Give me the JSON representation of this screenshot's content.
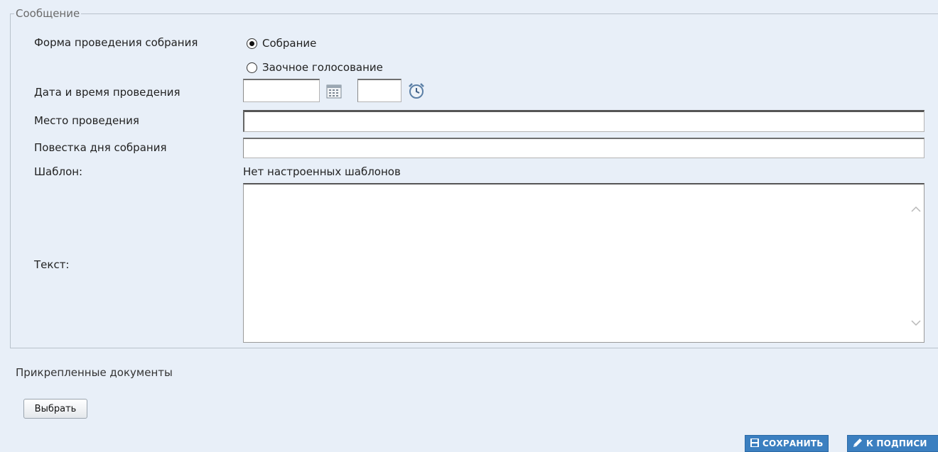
{
  "section": {
    "legend": "Сообщение"
  },
  "form": {
    "meeting_form_label": "Форма проведения собрания",
    "meeting_form_options": [
      {
        "label": "Собрание",
        "selected": true
      },
      {
        "label": "Заочное голосование",
        "selected": false
      }
    ],
    "datetime_label": "Дата и время проведения",
    "date_value": "",
    "time_value": "",
    "place_label": "Место проведения",
    "place_value": "",
    "agenda_label": "Повестка дня собрания",
    "agenda_value": "",
    "template_label": "Шаблон:",
    "template_value": "Нет настроенных шаблонов",
    "text_label": "Текст:",
    "text_value": ""
  },
  "attachments": {
    "title": "Прикрепленные документы",
    "choose_button": "Выбрать"
  },
  "actions": {
    "save_label": "СОХРАНИТЬ",
    "sign_label": "К ПОДПИСИ"
  },
  "icons": {
    "calendar": "calendar-icon",
    "clock": "alarm-clock-icon",
    "save": "floppy-disk-icon",
    "sign": "pen-icon"
  },
  "colors": {
    "background": "#e8eff8",
    "button_primary": "#3b7fc0"
  }
}
